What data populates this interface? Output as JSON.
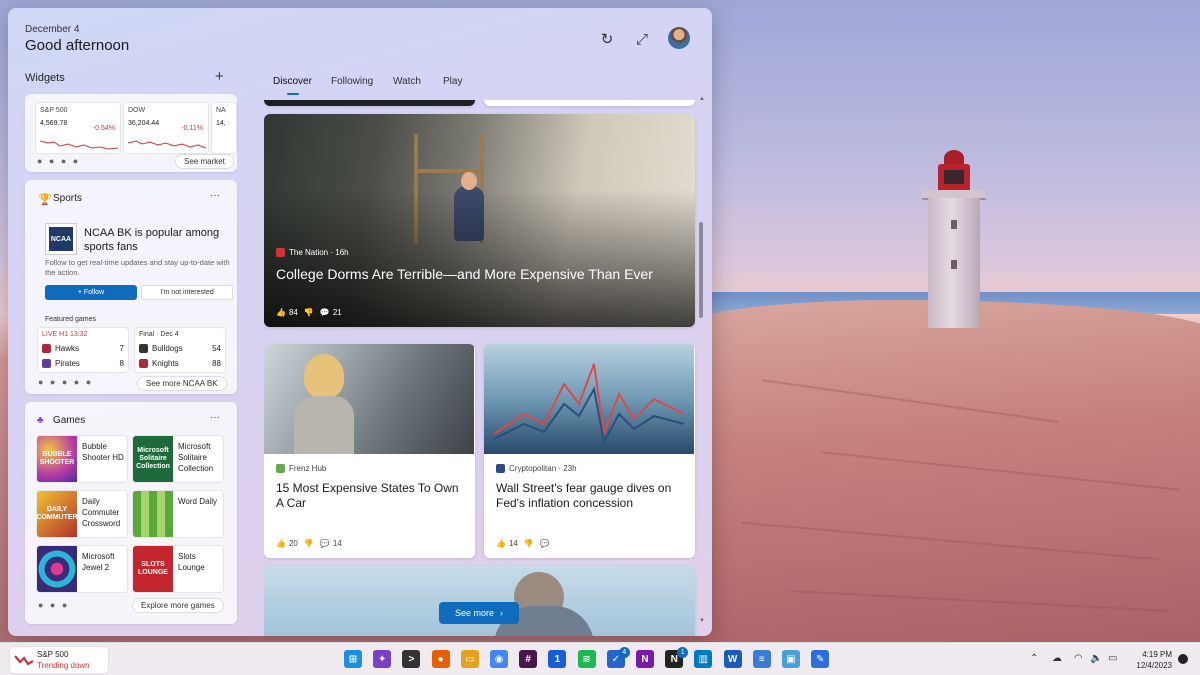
{
  "header": {
    "date": "December 4",
    "greeting": "Good afternoon"
  },
  "widgets": {
    "label": "Widgets"
  },
  "markets": {
    "stocks": [
      {
        "symbol": "S&P 500",
        "value": "4,569.78",
        "change": "-0.54%"
      },
      {
        "symbol": "DOW",
        "value": "36,204.44",
        "change": "-0.11%"
      },
      {
        "symbol": "NA",
        "value": "14,",
        "change": ""
      }
    ],
    "see_market": "See market"
  },
  "sports": {
    "title": "Sports",
    "logo_text": "NCAA",
    "headline": "NCAA BK is popular among sports fans",
    "subtitle": "Follow to get real-time updates and stay up-to-date with the action.",
    "follow": "+ Follow",
    "not_interested": "I'm not interested",
    "featured_label": "Featured games",
    "games": [
      {
        "status": "LIVE H1 13:32",
        "status_color": "#d13438",
        "teams": [
          {
            "name": "Hawks",
            "score": "7",
            "color": "#b0263a"
          },
          {
            "name": "Pirates",
            "score": "8",
            "color": "#5b3f9b"
          }
        ]
      },
      {
        "status": "Final · Dec 4",
        "status_color": "#333333",
        "teams": [
          {
            "name": "Bulldogs",
            "score": "54",
            "color": "#333333"
          },
          {
            "name": "Knights",
            "score": "88",
            "color": "#b0263a"
          }
        ]
      }
    ],
    "see_more": "See more NCAA BK"
  },
  "games_widget": {
    "title": "Games",
    "items": [
      {
        "name": "Bubble Shooter HD",
        "thumb_text": "BUBBLE SHOOTER",
        "color": "#7b2fbf"
      },
      {
        "name": "Microsoft Solitaire Collection",
        "thumb_text": "Microsoft Solitaire Collection",
        "color": "#1d6b3a"
      },
      {
        "name": "Daily Commuter Crossword",
        "thumb_text": "DAILY COMMUTER",
        "color": "#b2332a"
      },
      {
        "name": "Word Daily",
        "thumb_text": "",
        "color": "#5aa83c"
      },
      {
        "name": "Microsoft Jewel 2",
        "thumb_text": "",
        "color": "#3b2a7a"
      },
      {
        "name": "Slots Lounge",
        "thumb_text": "SLOTS LOUNGE",
        "color": "#c4262e"
      }
    ],
    "explore": "Explore more games"
  },
  "feed": {
    "tabs": [
      "Discover",
      "Following",
      "Watch",
      "Play"
    ],
    "active_tab": "Discover",
    "hero": {
      "source": "The Nation · 16h",
      "source_color": "#d13438",
      "headline": "College Dorms Are Terrible—and More Expensive Than Ever",
      "likes": "84",
      "comments": "21"
    },
    "cards": [
      {
        "source": "Frenz Hub",
        "source_color": "#6aa84f",
        "headline": "15 Most Expensive States To Own A Car",
        "likes": "20",
        "comments": "14"
      },
      {
        "source": "Cryptopolitan · 23h",
        "source_color": "#2b4a8a",
        "headline": "Wall Street's fear gauge dives on Fed's inflation concession",
        "likes": "14",
        "comments": ""
      }
    ],
    "see_more": "See more"
  },
  "taskbar": {
    "widget_title": "S&P 500",
    "widget_status": "Trending down",
    "apps": [
      {
        "name": "start",
        "color": "#1d8fe1",
        "glyph": "⊞"
      },
      {
        "name": "photos",
        "color": "#7a3fc8",
        "glyph": "✦"
      },
      {
        "name": "terminal",
        "color": "#333333",
        "glyph": ">"
      },
      {
        "name": "firefox",
        "color": "#e66000",
        "glyph": "●"
      },
      {
        "name": "file-explorer",
        "color": "#e3a21a",
        "glyph": "▭"
      },
      {
        "name": "chrome",
        "color": "#4285f4",
        "glyph": "◉"
      },
      {
        "name": "slack",
        "color": "#4a154b",
        "glyph": "#"
      },
      {
        "name": "1password",
        "color": "#1a5dd8",
        "glyph": "1"
      },
      {
        "name": "spotify",
        "color": "#1db954",
        "glyph": "≋"
      },
      {
        "name": "todo",
        "color": "#2564cf",
        "glyph": "✓"
      },
      {
        "name": "onenote",
        "color": "#7719aa",
        "glyph": "N"
      },
      {
        "name": "notion",
        "color": "#222222",
        "glyph": "N"
      },
      {
        "name": "trello",
        "color": "#0079bf",
        "glyph": "▥"
      },
      {
        "name": "word",
        "color": "#185abd",
        "glyph": "W"
      },
      {
        "name": "notepad",
        "color": "#3a7bd5",
        "glyph": "≡"
      },
      {
        "name": "remote-desktop",
        "color": "#4a9fd8",
        "glyph": "▣"
      },
      {
        "name": "paint",
        "color": "#2a6fdb",
        "glyph": "✎"
      }
    ],
    "badges": {
      "todo": "4",
      "notion": "1"
    },
    "time": "4:19 PM",
    "date": "12/4/2023"
  }
}
